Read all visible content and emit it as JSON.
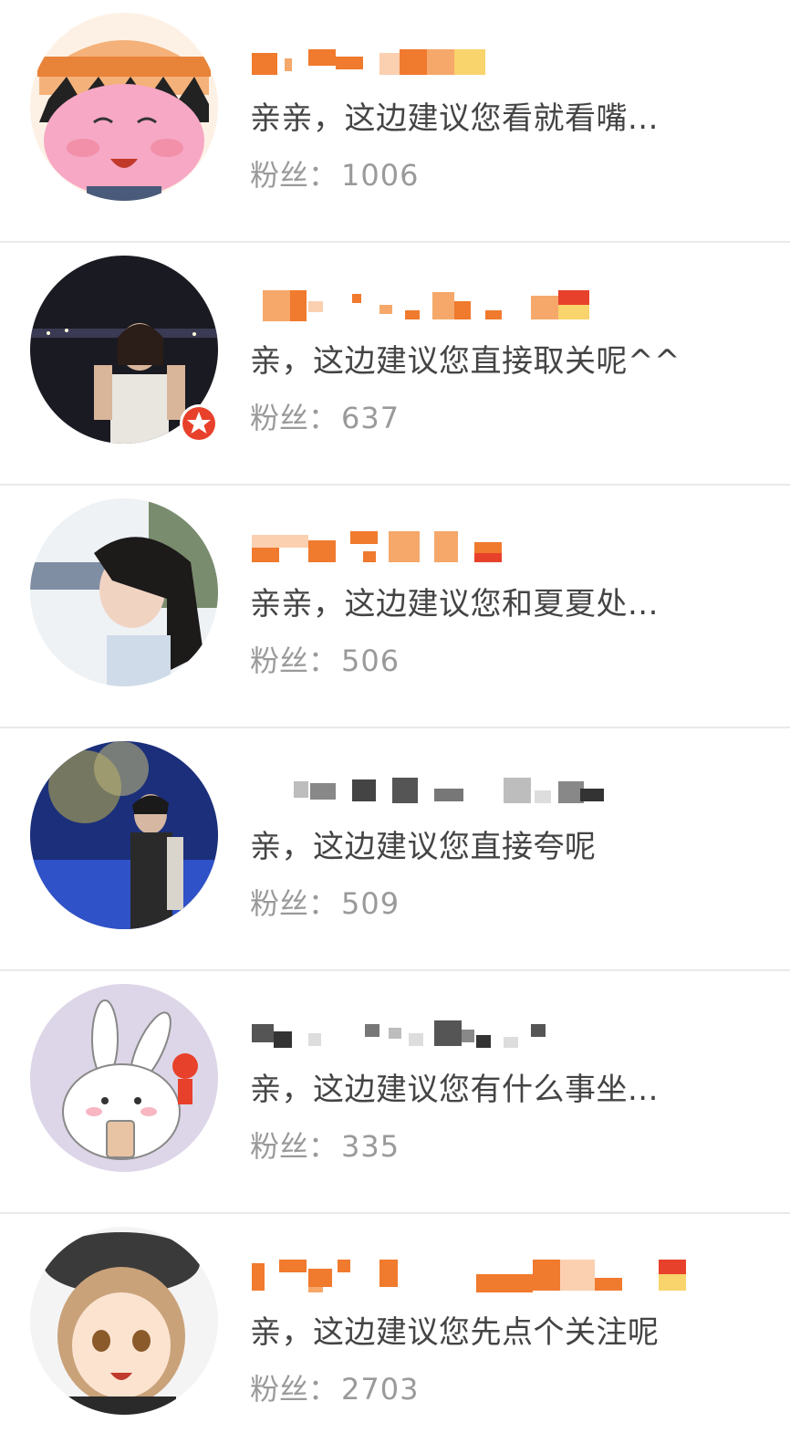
{
  "fans_label": "粉丝：",
  "colors": {
    "bio_text": "#444444",
    "fans_text": "#9a9a9a",
    "divider": "#e9e9e9",
    "name_mosaic_orange": "#f07a2e",
    "name_mosaic_gray": "#555555",
    "badge_red": "#e8412b"
  },
  "users": [
    {
      "avatar": "cartoon-girl-orange-hat-avatar",
      "name_visible": false,
      "bio": "亲亲，这边建议您看就看嘴...",
      "fans": "1006"
    },
    {
      "avatar": "photo-girl-night-avatar",
      "name_visible": false,
      "verified_badge": "star-badge-icon",
      "bio": "亲，这边建议您直接取关呢^^",
      "fans": "637"
    },
    {
      "avatar": "photo-girl-windblown-hair-avatar",
      "name_visible": false,
      "bio": "亲亲，这边建议您和夏夏处...",
      "fans": "506"
    },
    {
      "avatar": "photo-person-blue-lights-avatar",
      "name_visible": false,
      "bio": "亲，这边建议您直接夸呢",
      "fans": "509"
    },
    {
      "avatar": "cartoon-rabbit-bubble-tea-avatar",
      "name_visible": false,
      "bio": "亲，这边建议您有什么事坐...",
      "fans": "335"
    },
    {
      "avatar": "anime-girl-beret-avatar",
      "name_visible": false,
      "bio": "亲，这边建议您先点个关注呢",
      "fans": "2703"
    }
  ]
}
